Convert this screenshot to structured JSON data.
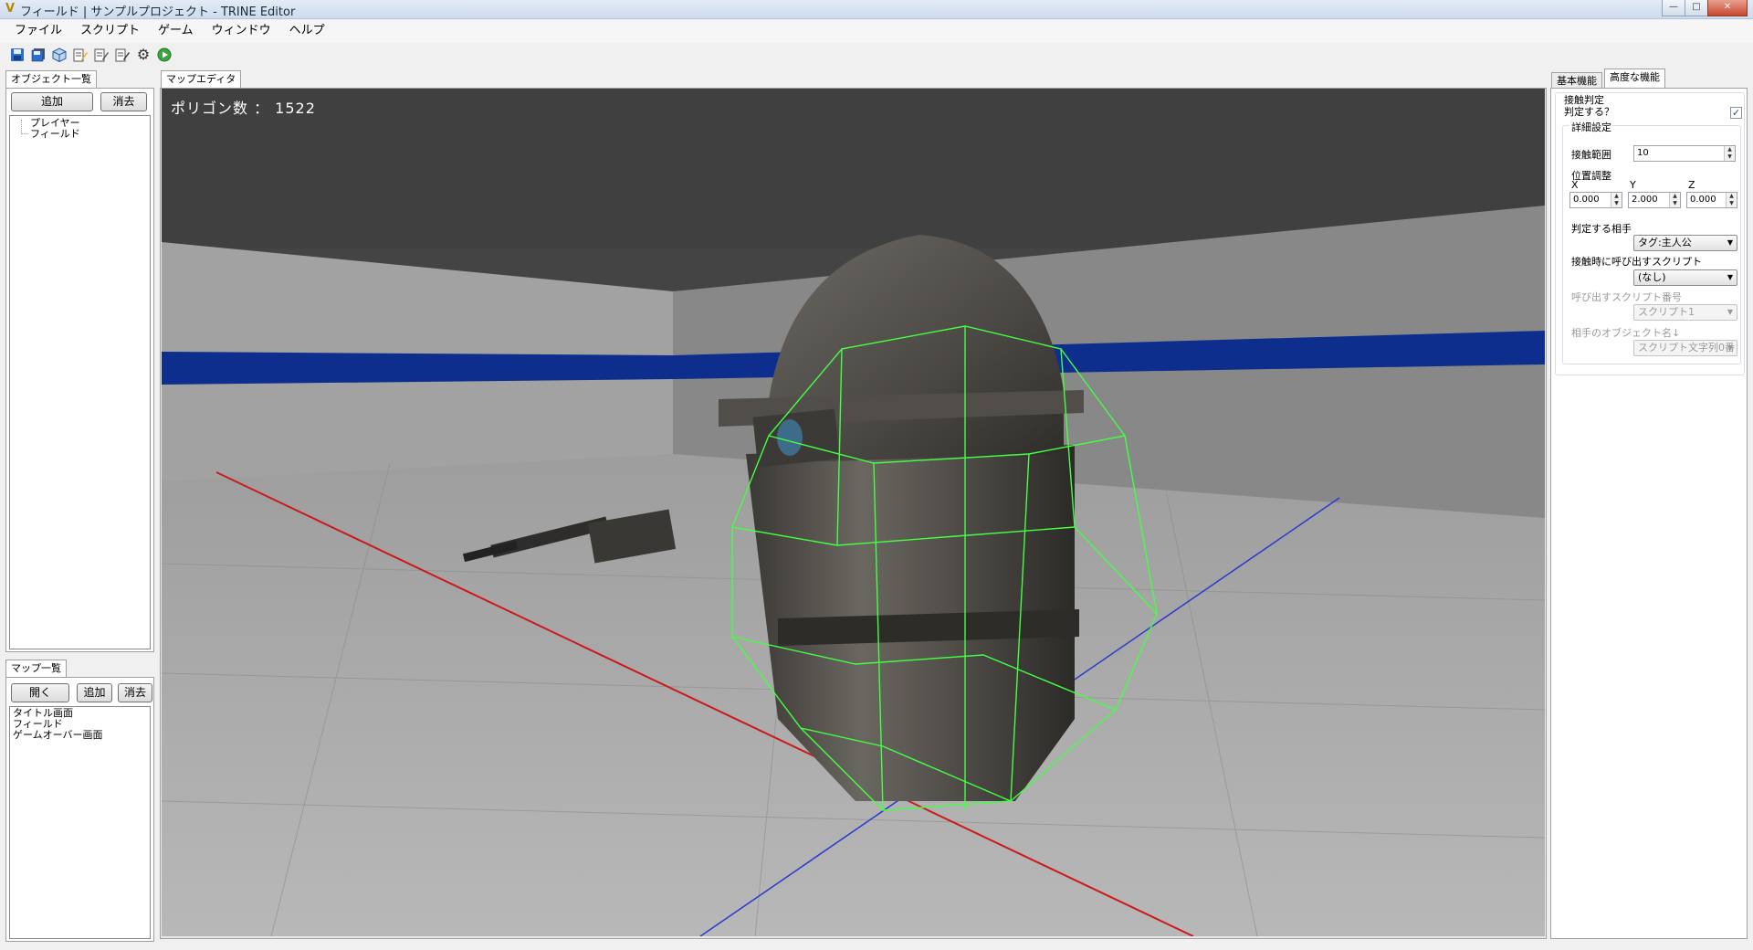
{
  "window": {
    "title": "フィールド | サンプルプロジェクト - TRINE Editor",
    "app_icon": "V",
    "controls": [
      "minimize-icon",
      "maximize-icon",
      "close-icon"
    ]
  },
  "menu": [
    "ファイル",
    "スクリプト",
    "ゲーム",
    "ウィンドウ",
    "ヘルプ"
  ],
  "toolbar": {
    "icons": [
      "save-icon",
      "save-all-icon",
      "cube-icon",
      "edit-script-icon",
      "edit-script-2-icon",
      "edit-script-3-icon",
      "settings-gear-icon",
      "play-icon"
    ]
  },
  "object_panel": {
    "tab": "オブジェクト一覧",
    "add_label": "追加",
    "delete_label": "消去",
    "items": [
      "プレイヤー",
      "フィールド"
    ]
  },
  "map_panel": {
    "tab": "マップ一覧",
    "open_label": "開く",
    "add_label": "追加",
    "delete_label": "消去",
    "items": [
      "タイトル画面",
      "フィールド",
      "ゲームオーバー画面"
    ]
  },
  "map_editor": {
    "tab": "マップエディタ",
    "polygon_label": "ポリゴン数 ： 1522"
  },
  "right_panel": {
    "tabs": [
      "基本機能",
      "高度な機能"
    ],
    "collision_label": "接触判定",
    "judge_label": "判定する？",
    "judge_checked": true,
    "detail_label": "詳細設定",
    "range_label": "接触範囲",
    "range_value": "10",
    "position_label": "位置調整",
    "x_label": "X",
    "y_label": "Y",
    "z_label": "Z",
    "x_value": "0.000",
    "y_value": "2.000",
    "z_value": "0.000",
    "target_label": "判定する相手",
    "target_value": "タグ:主人公",
    "script_call_label": "接触時に呼び出すスクリプト",
    "script_call_value": "(なし)",
    "script_number_label": "呼び出すスクリプト番号",
    "script_number_value": "スクリプト1",
    "opponent_name_label": "相手のオブジェクト名↓",
    "opponent_name_value": "スクリプト文字列0番"
  },
  "colors": {
    "titlebar": "#d6e2f1",
    "wireframe": "#44ff44",
    "axis_x": "#cc1a1a",
    "axis_z": "#2a3acc",
    "wall_stripe": "#0d2e8c"
  }
}
